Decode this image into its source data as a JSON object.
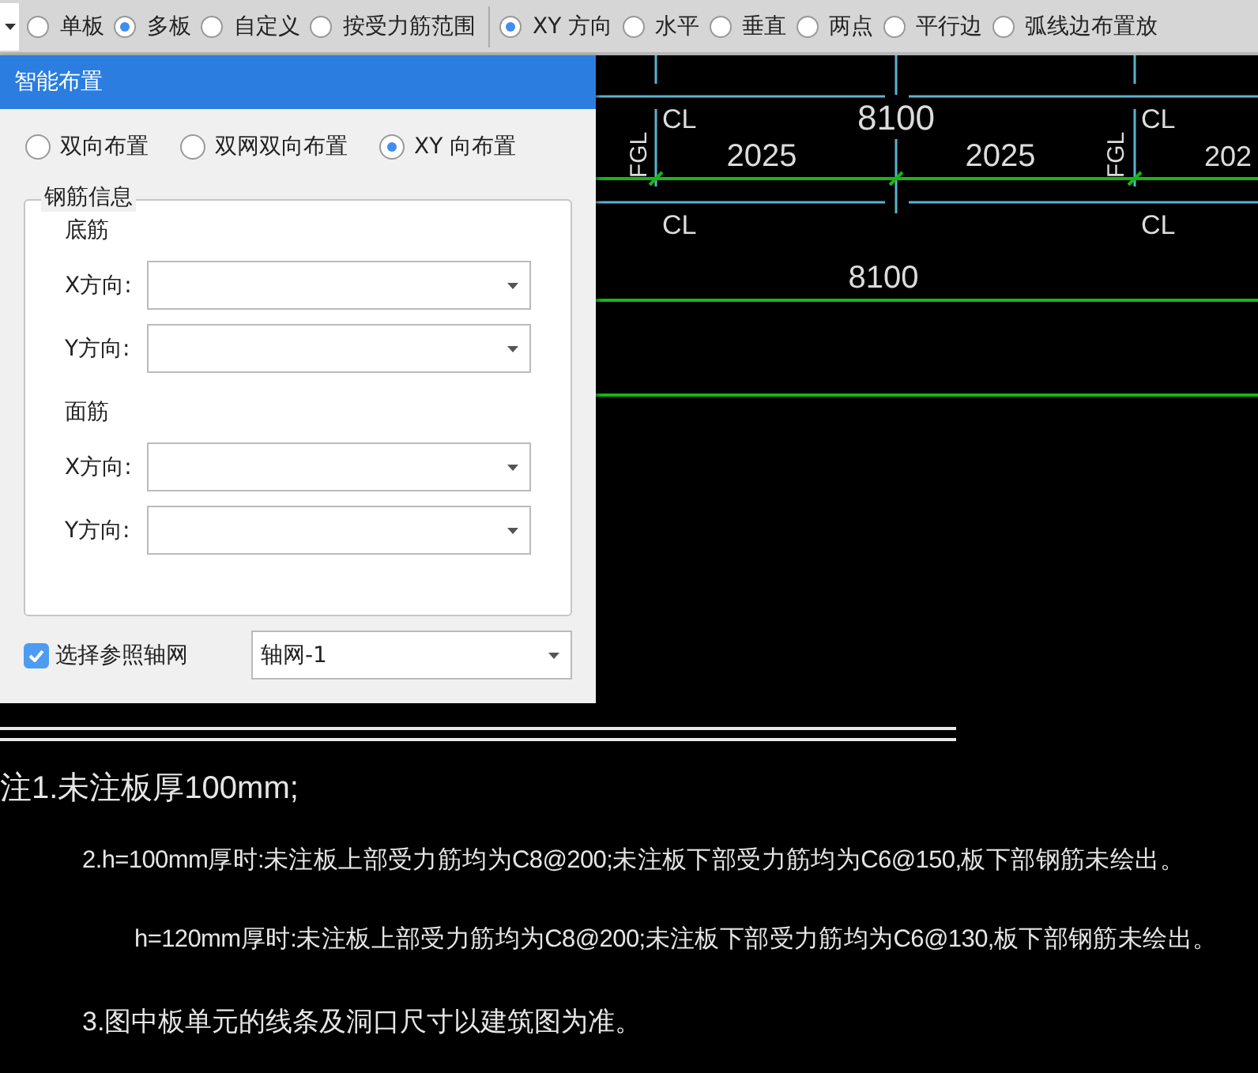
{
  "toolbar": {
    "groups": [
      {
        "options": [
          {
            "label": "单板",
            "selected": false
          },
          {
            "label": "多板",
            "selected": true
          },
          {
            "label": "自定义",
            "selected": false
          },
          {
            "label": "按受力筋范围",
            "selected": false
          }
        ]
      },
      {
        "options": [
          {
            "label": "XY 方向",
            "selected": true
          },
          {
            "label": "水平",
            "selected": false
          },
          {
            "label": "垂直",
            "selected": false
          },
          {
            "label": "两点",
            "selected": false
          },
          {
            "label": "平行边",
            "selected": false
          },
          {
            "label": "弧线边布置放",
            "selected": false
          }
        ]
      }
    ]
  },
  "dialog": {
    "title": "智能布置",
    "layout_options": [
      {
        "label": "双向布置",
        "selected": false
      },
      {
        "label": "双网双向布置",
        "selected": false
      },
      {
        "label": "XY 向布置",
        "selected": true
      }
    ],
    "group": {
      "title": "钢筋信息",
      "sections": [
        {
          "title": "底筋",
          "fields": [
            {
              "label": "X方向:"
            },
            {
              "label": "Y方向:"
            }
          ]
        },
        {
          "title": "面筋",
          "fields": [
            {
              "label": "X方向:"
            },
            {
              "label": "Y方向:"
            }
          ]
        }
      ]
    },
    "reference_grid": {
      "label": "选择参照轴网",
      "checked": true,
      "value": "轴网-1"
    }
  },
  "drawing": {
    "labels": [
      "CL",
      "8100",
      "CL",
      "FGL",
      "2025",
      "2025",
      "FGL",
      "202",
      "CL",
      "CL",
      "8100"
    ],
    "notes": [
      "注1.未注板厚100mm;",
      "2.h=100mm厚时:未注板上部受力筋均为C8@200;未注板下部受力筋均为C6@150,板下部钢筋未绘出。",
      "h=120mm厚时:未注板上部受力筋均为C8@200;未注板下部受力筋均为C6@130,板下部钢筋未绘出。",
      "3.图中板单元的线条及洞口尺寸以建筑图为准。"
    ]
  }
}
